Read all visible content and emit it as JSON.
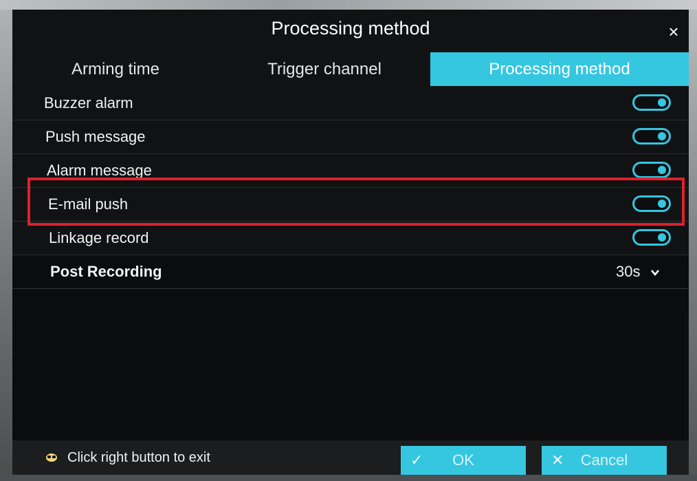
{
  "dialog": {
    "title": "Processing method",
    "close_icon": "close-icon"
  },
  "tabs": [
    {
      "label": "Arming time",
      "active": false
    },
    {
      "label": "Trigger channel",
      "active": false
    },
    {
      "label": "Processing method",
      "active": true
    }
  ],
  "settings": [
    {
      "label": "Buzzer alarm",
      "enabled": true
    },
    {
      "label": "Push message",
      "enabled": true
    },
    {
      "label": "Alarm message",
      "enabled": true
    },
    {
      "label": "E-mail push",
      "enabled": true,
      "highlighted": true
    },
    {
      "label": "Linkage record",
      "enabled": true
    }
  ],
  "post_recording": {
    "label": "Post Recording",
    "value": "30s"
  },
  "footer": {
    "hint_icon": "mouse-icon",
    "hint": "Click right button to exit",
    "ok_label": "OK",
    "cancel_label": "Cancel"
  },
  "colors": {
    "accent": "#35c6e0",
    "highlight_box": "#e0202b",
    "panel_bg": "#111213"
  }
}
